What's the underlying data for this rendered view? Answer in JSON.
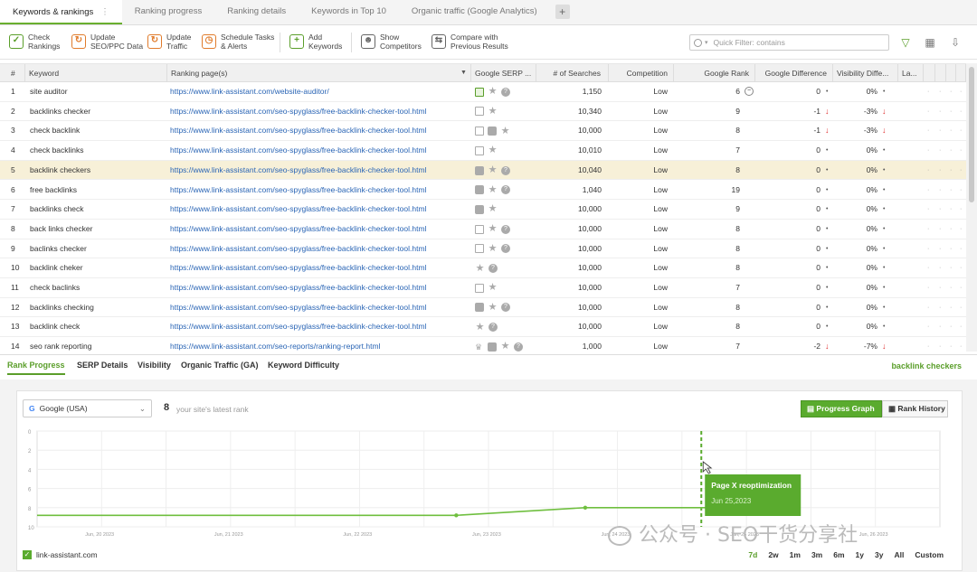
{
  "tabs": [
    "Keywords & rankings",
    "Ranking progress",
    "Ranking details",
    "Keywords in Top 10",
    "Organic traffic (Google Analytics)"
  ],
  "tab_menu_glyph": "⋮",
  "tab_add": "+",
  "toolbar": [
    {
      "l1": "Check",
      "l2": "Rankings",
      "icon": "check-rankings-icon"
    },
    {
      "l1": "Update",
      "l2": "SEO/PPC Data",
      "icon": "update-data-icon"
    },
    {
      "l1": "Update",
      "l2": "Traffic",
      "icon": "update-traffic-icon"
    },
    {
      "l1": "Schedule Tasks",
      "l2": "& Alerts",
      "icon": "schedule-icon"
    },
    {
      "l1": "Add",
      "l2": "Keywords",
      "icon": "add-keywords-icon"
    },
    {
      "l1": "Show",
      "l2": "Competitors",
      "icon": "competitors-icon"
    },
    {
      "l1": "Compare with",
      "l2": "Previous Results",
      "icon": "compare-icon"
    }
  ],
  "search": {
    "placeholder": "Quick Filter: contains"
  },
  "columns": [
    "#",
    "Keyword",
    "Ranking page(s)",
    "Google SERP ...",
    "# of Searches",
    "Competition",
    "Google Rank",
    "Google Difference",
    "Visibility Diffe...",
    "La..."
  ],
  "rows": [
    {
      "n": "1",
      "kw": "site auditor",
      "url": "https://www.link-assistant.com/website-auditor/",
      "serp": [
        "img-g",
        "star",
        "q"
      ],
      "searches": "1,150",
      "comp": "Low",
      "rank": "6",
      "rankcircle": true,
      "diff": "0",
      "diffdown": false,
      "vis": "0%",
      "visdown": false
    },
    {
      "n": "2",
      "kw": "backlinks checker",
      "url": "https://www.link-assistant.com/seo-spyglass/free-backlink-checker-tool.html",
      "serp": [
        "img",
        "star"
      ],
      "searches": "10,340",
      "comp": "Low",
      "rank": "9",
      "diff": "-1",
      "diffdown": true,
      "vis": "-3%",
      "visdown": true
    },
    {
      "n": "3",
      "kw": "check backlink",
      "url": "https://www.link-assistant.com/seo-spyglass/free-backlink-checker-tool.html",
      "serp": [
        "img",
        "vid",
        "star"
      ],
      "searches": "10,000",
      "comp": "Low",
      "rank": "8",
      "diff": "-1",
      "diffdown": true,
      "vis": "-3%",
      "visdown": true
    },
    {
      "n": "4",
      "kw": "check backlinks",
      "url": "https://www.link-assistant.com/seo-spyglass/free-backlink-checker-tool.html",
      "serp": [
        "img",
        "star"
      ],
      "searches": "10,010",
      "comp": "Low",
      "rank": "7",
      "diff": "0",
      "diffdown": false,
      "vis": "0%",
      "visdown": false
    },
    {
      "n": "5",
      "kw": "backlink checkers",
      "url": "https://www.link-assistant.com/seo-spyglass/free-backlink-checker-tool.html",
      "serp": [
        "vid",
        "star",
        "q"
      ],
      "searches": "10,040",
      "comp": "Low",
      "rank": "8",
      "diff": "0",
      "diffdown": false,
      "vis": "0%",
      "visdown": false,
      "selected": true
    },
    {
      "n": "6",
      "kw": "free backlinks",
      "url": "https://www.link-assistant.com/seo-spyglass/free-backlink-checker-tool.html",
      "serp": [
        "vid",
        "star",
        "q"
      ],
      "searches": "1,040",
      "comp": "Low",
      "rank": "19",
      "diff": "0",
      "diffdown": false,
      "vis": "0%",
      "visdown": false
    },
    {
      "n": "7",
      "kw": "backlinks check",
      "url": "https://www.link-assistant.com/seo-spyglass/free-backlink-checker-tool.html",
      "serp": [
        "vid",
        "star"
      ],
      "searches": "10,000",
      "comp": "Low",
      "rank": "9",
      "diff": "0",
      "diffdown": false,
      "vis": "0%",
      "visdown": false
    },
    {
      "n": "8",
      "kw": "back links checker",
      "url": "https://www.link-assistant.com/seo-spyglass/free-backlink-checker-tool.html",
      "serp": [
        "img",
        "star",
        "q"
      ],
      "searches": "10,000",
      "comp": "Low",
      "rank": "8",
      "diff": "0",
      "diffdown": false,
      "vis": "0%",
      "visdown": false
    },
    {
      "n": "9",
      "kw": "baclinks checker",
      "url": "https://www.link-assistant.com/seo-spyglass/free-backlink-checker-tool.html",
      "serp": [
        "img",
        "star",
        "q"
      ],
      "searches": "10,000",
      "comp": "Low",
      "rank": "8",
      "diff": "0",
      "diffdown": false,
      "vis": "0%",
      "visdown": false
    },
    {
      "n": "10",
      "kw": "backlink cheker",
      "url": "https://www.link-assistant.com/seo-spyglass/free-backlink-checker-tool.html",
      "serp": [
        "star",
        "q"
      ],
      "searches": "10,000",
      "comp": "Low",
      "rank": "8",
      "diff": "0",
      "diffdown": false,
      "vis": "0%",
      "visdown": false
    },
    {
      "n": "11",
      "kw": "check baclinks",
      "url": "https://www.link-assistant.com/seo-spyglass/free-backlink-checker-tool.html",
      "serp": [
        "img",
        "star"
      ],
      "searches": "10,000",
      "comp": "Low",
      "rank": "7",
      "diff": "0",
      "diffdown": false,
      "vis": "0%",
      "visdown": false
    },
    {
      "n": "12",
      "kw": "backlinks checking",
      "url": "https://www.link-assistant.com/seo-spyglass/free-backlink-checker-tool.html",
      "serp": [
        "vid",
        "star",
        "q"
      ],
      "searches": "10,000",
      "comp": "Low",
      "rank": "8",
      "diff": "0",
      "diffdown": false,
      "vis": "0%",
      "visdown": false
    },
    {
      "n": "13",
      "kw": "backlink check",
      "url": "https://www.link-assistant.com/seo-spyglass/free-backlink-checker-tool.html",
      "serp": [
        "star",
        "q"
      ],
      "searches": "10,000",
      "comp": "Low",
      "rank": "8",
      "diff": "0",
      "diffdown": false,
      "vis": "0%",
      "visdown": false
    },
    {
      "n": "14",
      "kw": "seo rank reporting",
      "url": "https://www.link-assistant.com/seo-reports/ranking-report.html",
      "serp": [
        "crown",
        "vid",
        "star",
        "q"
      ],
      "searches": "1,000",
      "comp": "Low",
      "rank": "7",
      "diff": "-2",
      "diffdown": true,
      "vis": "-7%",
      "visdown": true
    }
  ],
  "bottom_tabs": [
    "Rank Progress",
    "SERP Details",
    "Visibility",
    "Organic Traffic (GA)",
    "Keyword Difficulty"
  ],
  "selected_keyword": "backlink checkers",
  "panel": {
    "engine": "Google (USA)",
    "engine_logo": "G",
    "latest_rank": "8",
    "latest_label": "your site's latest rank",
    "progress_graph": "Progress Graph",
    "rank_history": "Rank History",
    "legend": "link-assistant.com",
    "ranges": [
      "7d",
      "2w",
      "1m",
      "3m",
      "6m",
      "1y",
      "3y",
      "All",
      "Custom"
    ],
    "active_range": "7d"
  },
  "chart_data": {
    "type": "line",
    "y_ticks": [
      "0",
      "2",
      "4",
      "6",
      "8",
      "10"
    ],
    "ylim": [
      0,
      10
    ],
    "x_ticks": [
      "Jun, 20 2023",
      "Jun, 21 2023",
      "Jun, 22 2023",
      "Jun, 23 2023",
      "Jun, 24 2023",
      "Jun, 25 2023",
      "Jun, 26 2023"
    ],
    "series": [
      {
        "values": [
          {
            "x": 0,
            "y": 8.8
          },
          {
            "x": 6.5,
            "y": 8.8
          },
          {
            "x": 8.5,
            "y": 8.0
          },
          {
            "x": 10.5,
            "y": 8.0
          }
        ]
      }
    ],
    "annotation": {
      "x": 6.0,
      "title": "Page X reoptimization",
      "date": "Jun 25,2023"
    },
    "colors": {
      "line": "#6fbf3f",
      "annotation_bg": "#5aab2e"
    }
  },
  "watermark": "公众号 · SEO干货分享社"
}
